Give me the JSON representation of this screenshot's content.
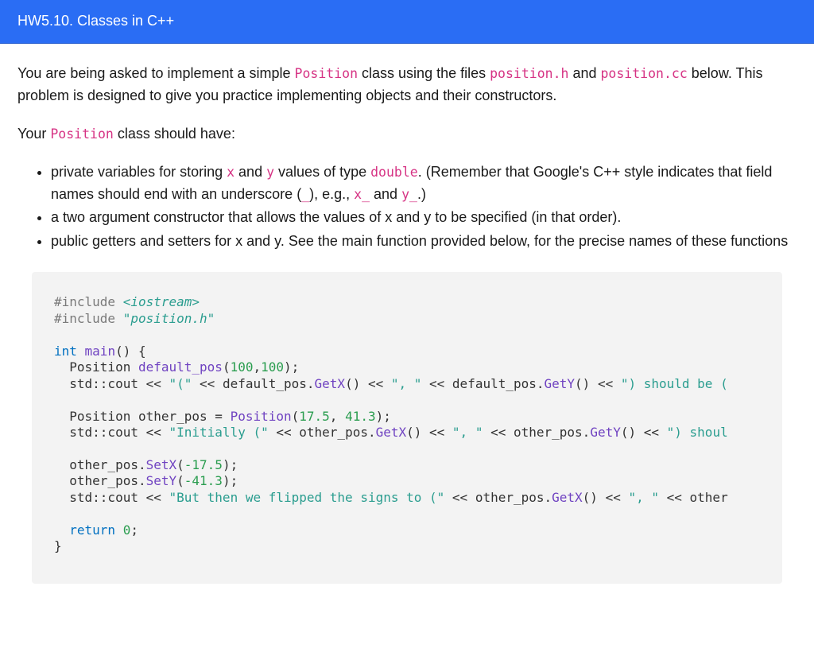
{
  "header": {
    "title": "HW5.10. Classes in C++"
  },
  "intro": {
    "t1": "You are being asked to implement a simple ",
    "c1": "Position",
    "t2": " class using the files ",
    "c2": "position.h",
    "t3": " and ",
    "c3": "position.cc",
    "t4": " below. This problem is designed to give you practice implementing objects and their constructors."
  },
  "lead": {
    "t1": "Your ",
    "c1": "Position",
    "t2": " class should have:"
  },
  "bullets": {
    "b1": {
      "t1": "private variables for storing ",
      "c1": "x",
      "t2": " and ",
      "c2": "y",
      "t3": " values of type ",
      "c3": "double",
      "t4": ". (Remember that Google's C++ style indicates that field names should end with an underscore (",
      "c4": "_",
      "t5": "), e.g., ",
      "c5": "x_",
      "t6": " and ",
      "c6": "y_",
      "t7": ".)"
    },
    "b2": "a two argument constructor that allows the values of x and y to be specified (in that order).",
    "b3": "public getters and setters for x and y. See the main function provided below, for the precise names of these functions"
  },
  "code": {
    "include1_pp": "#include ",
    "include1_ang": "<iostream>",
    "include2_pp": "#include ",
    "include2_str": "\"position.h\"",
    "main_kw_int": "int",
    "main_fn": " main",
    "main_paren": "() {",
    "l1a": "  Position ",
    "l1b": "default_pos",
    "l1c": "(",
    "l1n1": "100",
    "l1comma": ",",
    "l1n2": "100",
    "l1d": ");",
    "l2a": "  std::cout << ",
    "l2s1": "\"(\"",
    "l2b": " << default_pos.",
    "l2fn1": "GetX",
    "l2c": "() << ",
    "l2s2": "\", \"",
    "l2d": " << default_pos.",
    "l2fn2": "GetY",
    "l2e": "() << ",
    "l2s3": "\") should be (",
    "l3a": "  Position other_pos = ",
    "l3fn": "Position",
    "l3b": "(",
    "l3n1": "17.5",
    "l3c": ", ",
    "l3n2": "41.3",
    "l3d": ");",
    "l4a": "  std::cout << ",
    "l4s1": "\"Initially (\"",
    "l4b": " << other_pos.",
    "l4fn1": "GetX",
    "l4c": "() << ",
    "l4s2": "\", \"",
    "l4d": " << other_pos.",
    "l4fn2": "GetY",
    "l4e": "() << ",
    "l4s3": "\") shoul",
    "l5a": "  other_pos.",
    "l5fn": "SetX",
    "l5b": "(",
    "l5n": "-17.5",
    "l5c": ");",
    "l6a": "  other_pos.",
    "l6fn": "SetY",
    "l6b": "(",
    "l6n": "-41.3",
    "l6c": ");",
    "l7a": "  std::cout << ",
    "l7s1": "\"But then we flipped the signs to (\"",
    "l7b": " << other_pos.",
    "l7fn1": "GetX",
    "l7c": "() << ",
    "l7s2": "\", \"",
    "l7d": " << other",
    "ret_kw": "  return",
    "ret_n": " 0",
    "ret_semi": ";",
    "close": "}"
  }
}
